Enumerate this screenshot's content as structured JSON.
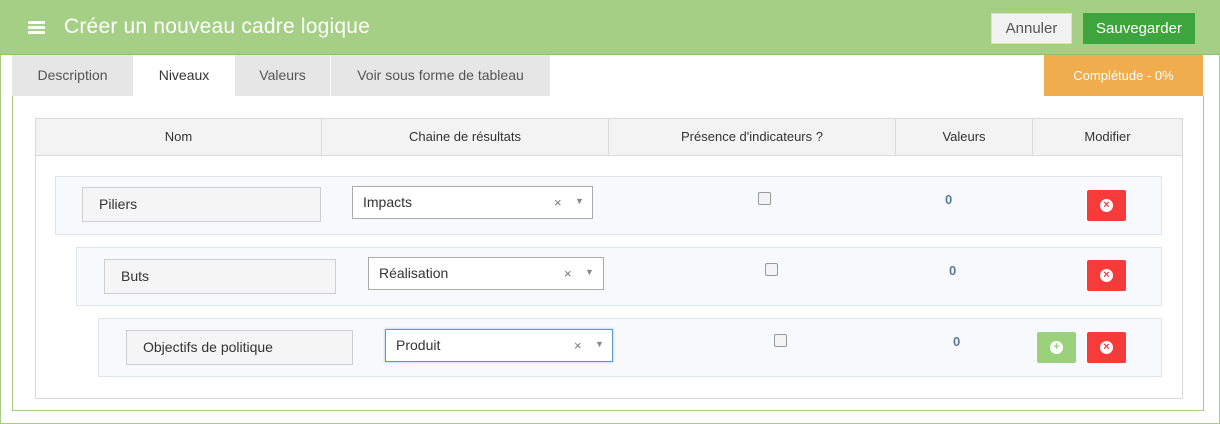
{
  "header": {
    "title": "Créer un nouveau cadre logique",
    "cancel_label": "Annuler",
    "save_label": "Sauvegarder",
    "menu_icon": "hamburger-icon"
  },
  "tabs": [
    {
      "label": "Description",
      "active": false
    },
    {
      "label": "Niveaux",
      "active": true
    },
    {
      "label": "Valeurs",
      "active": false
    },
    {
      "label": "Voir sous forme de tableau",
      "active": false
    }
  ],
  "completion": {
    "label": "Complétude - 0%",
    "percent": 0
  },
  "table": {
    "headers": [
      "Nom",
      "Chaine de résultats",
      "Présence d'indicateurs ?",
      "Valeurs",
      "Modifier"
    ],
    "rows": [
      {
        "name": "Piliers",
        "chain": "Impacts",
        "clear": "×",
        "has_indicators": false,
        "values": "0"
      },
      {
        "name": "Buts",
        "chain": "Réalisation",
        "clear": "×",
        "has_indicators": false,
        "values": "0"
      },
      {
        "name": "Objectifs de politique",
        "chain": "Produit",
        "clear": "×",
        "has_indicators": false,
        "values": "0"
      }
    ]
  },
  "icons": {
    "delete": "times-circle-icon",
    "add": "plus-circle-icon",
    "dropdown": "caret-down-icon"
  },
  "colors": {
    "header": "#a4cf85",
    "save": "#3ea43e",
    "completion": "#f0ad4e",
    "delete": "#f73b3b",
    "add": "#9bd17b"
  }
}
